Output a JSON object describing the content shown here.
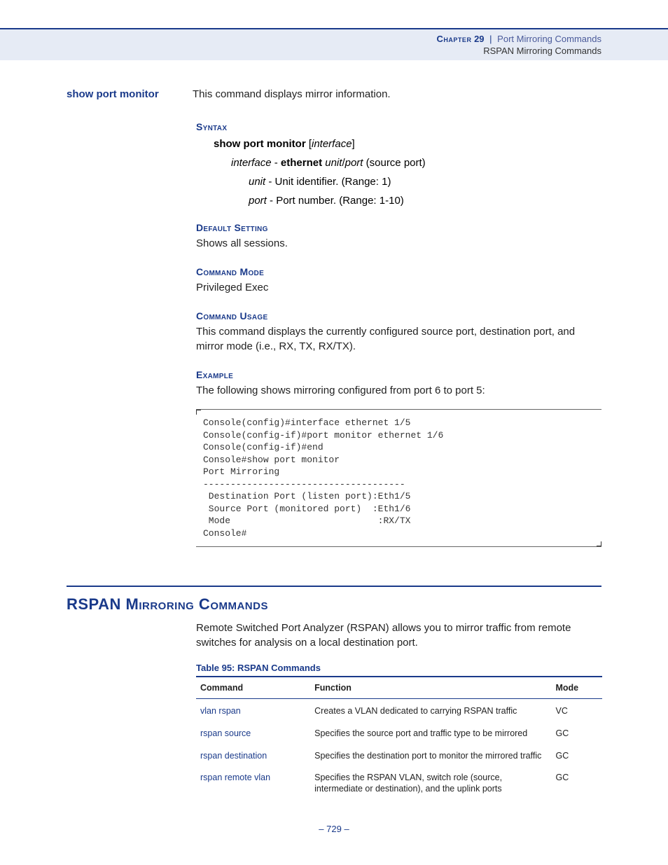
{
  "header": {
    "chapter_label": "Chapter",
    "chapter_num": "29",
    "pipe": "|",
    "chapter_title": "Port Mirroring Commands",
    "subtitle": "RSPAN Mirroring Commands"
  },
  "cmd": {
    "name": "show port monitor",
    "desc": "This command displays mirror information."
  },
  "syntax": {
    "heading": "Syntax",
    "line1_bold": "show port monitor",
    "line1_open": " [",
    "line1_ital": "interface",
    "line1_close": "]",
    "line2_ital1": "interface",
    "line2_dash": " - ",
    "line2_bold": "ethernet",
    "line2_space": " ",
    "line2_ital2": "unit",
    "line2_slash": "/",
    "line2_ital3": "port",
    "line2_tail": " (source port)",
    "line3_ital": "unit",
    "line3_text": " - Unit identifier. (Range: 1)",
    "line4_ital": "port",
    "line4_text": " - Port number. (Range: 1-10)"
  },
  "default_setting": {
    "heading": "Default Setting",
    "text": "Shows all sessions."
  },
  "command_mode": {
    "heading": "Command Mode",
    "text": "Privileged Exec"
  },
  "command_usage": {
    "heading": "Command Usage",
    "text": "This command displays the currently configured source port, destination port, and mirror mode (i.e., RX, TX, RX/TX)."
  },
  "example": {
    "heading": "Example",
    "intro": "The following shows mirroring configured from port 6 to port 5:",
    "code": "Console(config)#interface ethernet 1/5\nConsole(config-if)#port monitor ethernet 1/6\nConsole(config-if)#end\nConsole#show port monitor\nPort Mirroring\n-------------------------------------\n Destination Port (listen port):Eth1/5\n Source Port (monitored port)  :Eth1/6\n Mode                           :RX/TX\nConsole#"
  },
  "rspan": {
    "title": "RSPAN Mirroring Commands",
    "intro": "Remote Switched Port Analyzer (RSPAN) allows you to mirror traffic from remote switches for analysis on a local destination port.",
    "table_caption": "Table 95: RSPAN Commands",
    "headers": {
      "command": "Command",
      "function": "Function",
      "mode": "Mode"
    },
    "rows": [
      {
        "command": "vlan rspan",
        "function": "Creates a VLAN dedicated to carrying RSPAN traffic",
        "mode": "VC"
      },
      {
        "command": "rspan source",
        "function": "Specifies the source port and traffic type to be mirrored",
        "mode": "GC"
      },
      {
        "command": "rspan destination",
        "function": "Specifies the destination port to monitor the mirrored traffic",
        "mode": "GC"
      },
      {
        "command": "rspan remote vlan",
        "function": "Specifies the RSPAN VLAN, switch role (source, intermediate or destination), and the uplink ports",
        "mode": "GC"
      }
    ]
  },
  "footer": {
    "dash1": "– ",
    "page": "729",
    "dash2": " –"
  }
}
